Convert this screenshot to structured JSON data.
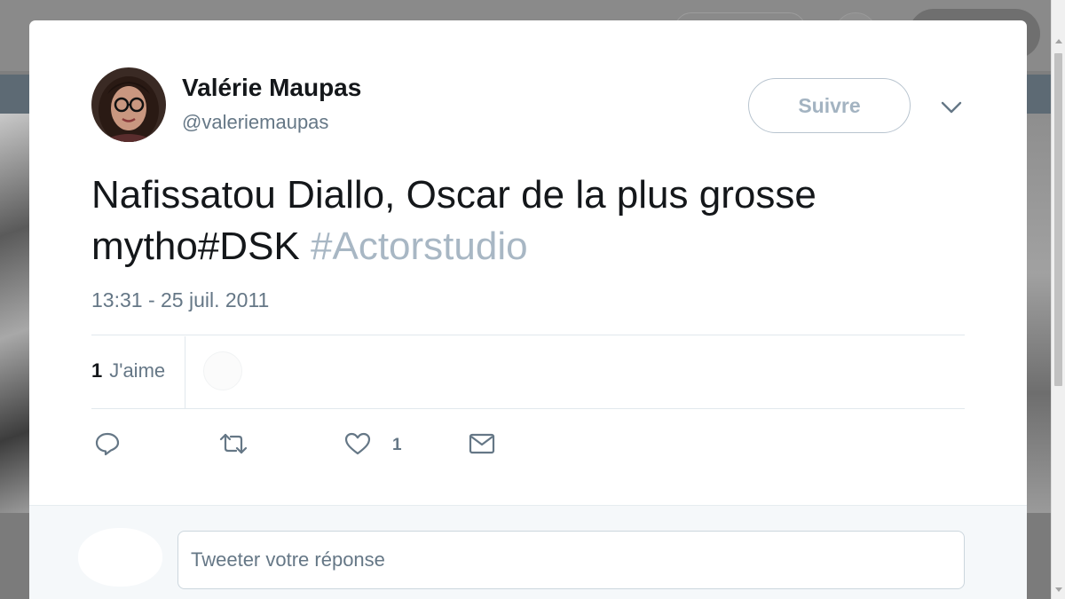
{
  "tweet": {
    "author_name": "Valérie Maupas",
    "author_handle": "@valeriemaupas",
    "follow_label": "Suivre",
    "text": "Nafissatou Diallo, Oscar de la plus grosse mytho#DSK",
    "hashtag": "#Actorstudio",
    "timestamp": "13:31 - 25 juil. 2011",
    "likes_count": "1",
    "likes_label": "J'aime",
    "like_action_count": "1"
  },
  "reply": {
    "placeholder": "Tweeter votre réponse"
  },
  "icons": {
    "reply": "reply-icon",
    "retweet": "retweet-icon",
    "like": "heart-icon",
    "message": "envelope-icon",
    "menu": "chevron-down-icon"
  },
  "colors": {
    "text": "#14171a",
    "secondary": "#657786",
    "hashtag": "#a8b7c4",
    "follow_border": "#b8c4cf"
  }
}
